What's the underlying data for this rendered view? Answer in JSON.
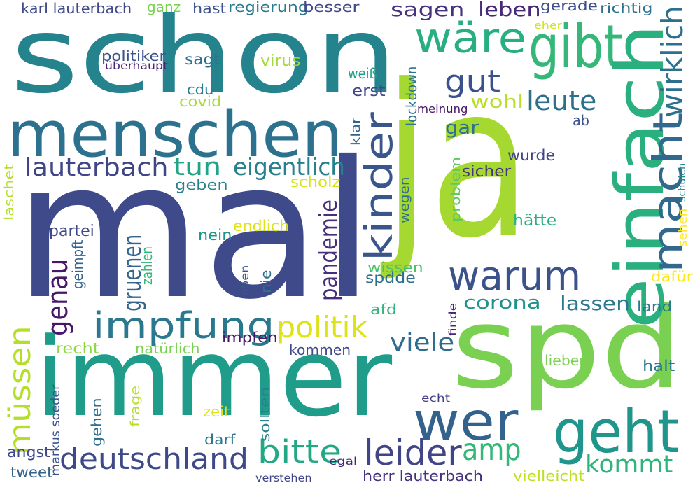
{
  "words": [
    {
      "text": "mal",
      "color": "#3e4a89",
      "rotated": false
    },
    {
      "text": "ja",
      "color": "#a6d832",
      "rotated": false
    },
    {
      "text": "schon",
      "color": "#25838e",
      "rotated": false
    },
    {
      "text": "immer",
      "color": "#1f9d8a",
      "rotated": false
    },
    {
      "text": "spd",
      "color": "#7ad151",
      "rotated": false
    },
    {
      "text": "menschen",
      "color": "#2c718e",
      "rotated": false
    },
    {
      "text": "gibt",
      "color": "#35b779",
      "rotated": false
    },
    {
      "text": "einfach",
      "color": "#2ab07f",
      "rotated": true
    },
    {
      "text": "wäre",
      "color": "#28ae80",
      "rotated": false
    },
    {
      "text": "geht",
      "color": "#1f958b",
      "rotated": false
    },
    {
      "text": "wer",
      "color": "#33638d",
      "rotated": false
    },
    {
      "text": "warum",
      "color": "#3b528b",
      "rotated": false
    },
    {
      "text": "kinder",
      "color": "#39568c",
      "rotated": true
    },
    {
      "text": "macht",
      "color": "#31688e",
      "rotated": true
    },
    {
      "text": "impfung",
      "color": "#2a788e",
      "rotated": false
    },
    {
      "text": "deutschland",
      "color": "#3e4989",
      "rotated": false
    },
    {
      "text": "politik",
      "color": "#dde318",
      "rotated": false
    },
    {
      "text": "bitte",
      "color": "#22a884",
      "rotated": false
    },
    {
      "text": "leider",
      "color": "#414487",
      "rotated": false
    },
    {
      "text": "müssen",
      "color": "#b5de2b",
      "rotated": true
    },
    {
      "text": "lauterbach",
      "color": "#404588",
      "rotated": false
    },
    {
      "text": "wirklich",
      "color": "#2d708e",
      "rotated": true
    },
    {
      "text": "gut",
      "color": "#3b518b",
      "rotated": false
    },
    {
      "text": "leute",
      "color": "#2e6f8e",
      "rotated": false
    },
    {
      "text": "amp",
      "color": "#35b779",
      "rotated": false
    },
    {
      "text": "kommt",
      "color": "#2fb47c",
      "rotated": false
    },
    {
      "text": "genau",
      "color": "#481769",
      "rotated": true
    },
    {
      "text": "gruenen",
      "color": "#32648e",
      "rotated": true
    },
    {
      "text": "eigentlich",
      "color": "#27808e",
      "rotated": false
    },
    {
      "text": "tun",
      "color": "#20a386",
      "rotated": false
    },
    {
      "text": "pandemie",
      "color": "#472d7b",
      "rotated": true
    },
    {
      "text": "viele",
      "color": "#2f6c8e",
      "rotated": false
    },
    {
      "text": "corona",
      "color": "#21918c",
      "rotated": false
    },
    {
      "text": "sagen",
      "color": "#46327e",
      "rotated": false
    },
    {
      "text": "leben",
      "color": "#482878",
      "rotated": false
    },
    {
      "text": "lassen",
      "color": "#2a778e",
      "rotated": false
    },
    {
      "text": "wohl",
      "color": "#b8de29",
      "rotated": false
    },
    {
      "text": "gar",
      "color": "#2c718e",
      "rotated": false
    },
    {
      "text": "karl lauterbach",
      "color": "#3e4989",
      "rotated": false
    },
    {
      "text": "ganz",
      "color": "#7ad151",
      "rotated": false
    },
    {
      "text": "hast",
      "color": "#3b528b",
      "rotated": false
    },
    {
      "text": "regierung",
      "color": "#2a788e",
      "rotated": false
    },
    {
      "text": "besser",
      "color": "#3f4788",
      "rotated": false
    },
    {
      "text": "gerade",
      "color": "#3e4c8a",
      "rotated": false
    },
    {
      "text": "richtig",
      "color": "#2c728e",
      "rotated": false
    },
    {
      "text": "eher",
      "color": "#d2e21b",
      "rotated": false
    },
    {
      "text": "politiker",
      "color": "#3b528b",
      "rotated": false
    },
    {
      "text": "überhaupt",
      "color": "#482071",
      "rotated": false
    },
    {
      "text": "sagt",
      "color": "#2e6e8e",
      "rotated": false
    },
    {
      "text": "virus",
      "color": "#a2da37",
      "rotated": false
    },
    {
      "text": "weiß",
      "color": "#1f9f88",
      "rotated": false
    },
    {
      "text": "cdu",
      "color": "#287d8e",
      "rotated": false
    },
    {
      "text": "covid",
      "color": "#a5db36",
      "rotated": false
    },
    {
      "text": "erst",
      "color": "#404588",
      "rotated": false
    },
    {
      "text": "lockdown",
      "color": "#2b748e",
      "rotated": true
    },
    {
      "text": "meinung",
      "color": "#471365",
      "rotated": false
    },
    {
      "text": "klar",
      "color": "#33628d",
      "rotated": true
    },
    {
      "text": "ab",
      "color": "#3b528b",
      "rotated": false
    },
    {
      "text": "wurde",
      "color": "#414487",
      "rotated": false
    },
    {
      "text": "sicher",
      "color": "#46337e",
      "rotated": false
    },
    {
      "text": "geben",
      "color": "#27808e",
      "rotated": false
    },
    {
      "text": "scholz",
      "color": "#d8e219",
      "rotated": false
    },
    {
      "text": "laschet",
      "color": "#b5de2b",
      "rotated": true
    },
    {
      "text": "problem",
      "color": "#5ec962",
      "rotated": true
    },
    {
      "text": "wegen",
      "color": "#2e6e8e",
      "rotated": true
    },
    {
      "text": "schulen",
      "color": "#23888e",
      "rotated": true
    },
    {
      "text": "sehen",
      "color": "#fde725",
      "rotated": true
    },
    {
      "text": "partei",
      "color": "#3e4989",
      "rotated": false
    },
    {
      "text": "nein",
      "color": "#1f968b",
      "rotated": false
    },
    {
      "text": "endlich",
      "color": "#dde318",
      "rotated": false
    },
    {
      "text": "hätte",
      "color": "#2ab07f",
      "rotated": false
    },
    {
      "text": "geimpft",
      "color": "#33638d",
      "rotated": true
    },
    {
      "text": "zahlen",
      "color": "#35b779",
      "rotated": true
    },
    {
      "text": "wissen",
      "color": "#4ac16d",
      "rotated": false
    },
    {
      "text": "spdde",
      "color": "#2e6e8e",
      "rotated": false
    },
    {
      "text": "dafür",
      "color": "#fde725",
      "rotated": false
    },
    {
      "text": "eben",
      "color": "#39568c",
      "rotated": true
    },
    {
      "text": "nie",
      "color": "#2d708e",
      "rotated": true
    },
    {
      "text": "afd",
      "color": "#2fb47c",
      "rotated": false
    },
    {
      "text": "finde",
      "color": "#482475",
      "rotated": true
    },
    {
      "text": "land",
      "color": "#2a788e",
      "rotated": false
    },
    {
      "text": "impfen",
      "color": "#481769",
      "rotated": false
    },
    {
      "text": "recht",
      "color": "#8fd744",
      "rotated": false
    },
    {
      "text": "natürlich",
      "color": "#7ad151",
      "rotated": false
    },
    {
      "text": "kommen",
      "color": "#3e4a89",
      "rotated": false
    },
    {
      "text": "lieber",
      "color": "#7ad151",
      "rotated": false
    },
    {
      "text": "halt",
      "color": "#2a788e",
      "rotated": false
    },
    {
      "text": "frage",
      "color": "#b8de29",
      "rotated": true
    },
    {
      "text": "markus soeder",
      "color": "#3b528b",
      "rotated": true
    },
    {
      "text": "gehen",
      "color": "#2e6e8e",
      "rotated": true
    },
    {
      "text": "zeit",
      "color": "#dde318",
      "rotated": false
    },
    {
      "text": "sollten",
      "color": "#26828e",
      "rotated": true
    },
    {
      "text": "echt",
      "color": "#433e85",
      "rotated": false
    },
    {
      "text": "darf",
      "color": "#2a788e",
      "rotated": false
    },
    {
      "text": "angst",
      "color": "#3f4788",
      "rotated": false
    },
    {
      "text": "tweet",
      "color": "#33638d",
      "rotated": false
    },
    {
      "text": "egal",
      "color": "#482576",
      "rotated": false
    },
    {
      "text": "herr lauterbach",
      "color": "#46307e",
      "rotated": false
    },
    {
      "text": "verstehen",
      "color": "#404588",
      "rotated": false
    },
    {
      "text": "vielleicht",
      "color": "#bddf26",
      "rotated": false
    }
  ]
}
